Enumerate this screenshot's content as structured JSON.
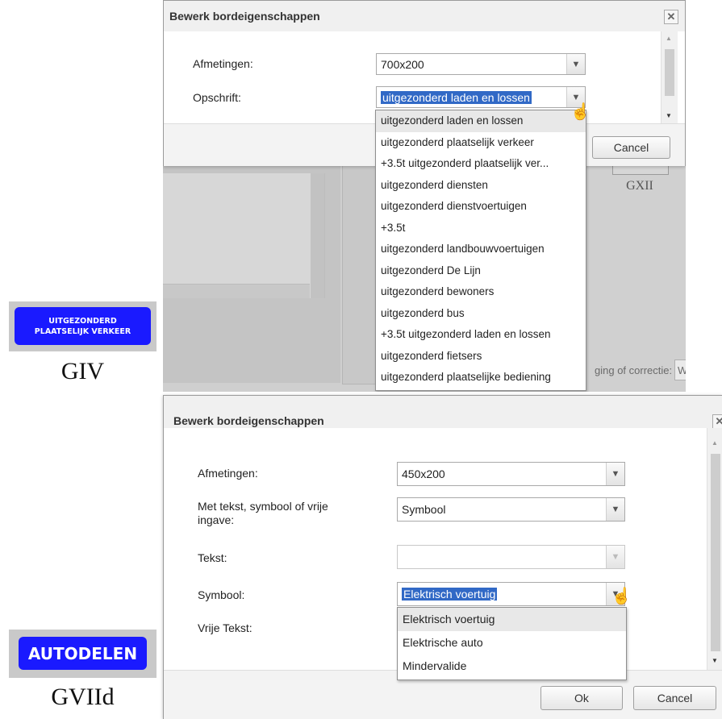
{
  "signs": [
    {
      "line1": "UITGEZONDERD",
      "line2": "PLAATSELIJK VERKEER",
      "code": "GIV"
    },
    {
      "line1": "AUTODELEN",
      "code": "GVIId"
    }
  ],
  "background": {
    "label_gxii": "GXII",
    "partial_text": "ging of correctie:",
    "partial_field": "W"
  },
  "dialog1": {
    "title": "Bewerk bordeigenschappen",
    "afmetingen_label": "Afmetingen:",
    "afmetingen_value": "700x200",
    "opschrift_label": "Opschrift:",
    "opschrift_value": "uitgezonderd laden en lossen",
    "cancel_label": "Cancel",
    "options": [
      "uitgezonderd laden en lossen",
      "uitgezonderd plaatselijk verkeer",
      "+3.5t uitgezonderd plaatselijk ver...",
      "uitgezonderd diensten",
      "uitgezonderd dienstvoertuigen",
      "+3.5t",
      "uitgezonderd landbouwvoertuigen",
      "uitgezonderd De Lijn",
      "uitgezonderd bewoners",
      "uitgezonderd bus",
      "+3.5t uitgezonderd laden en lossen",
      "uitgezonderd fietsers",
      "uitgezonderd plaatselijke bediening"
    ]
  },
  "dialog2": {
    "title": "Bewerk bordeigenschappen",
    "afmetingen_label": "Afmetingen:",
    "afmetingen_value": "450x200",
    "mode_label_line1": "Met tekst, symbool of vrije",
    "mode_label_line2": "ingave:",
    "mode_value": "Symbool",
    "tekst_label": "Tekst:",
    "tekst_value": "",
    "symbool_label": "Symbool:",
    "symbool_value": "Elektrisch voertuig",
    "vrije_tekst_label": "Vrije Tekst:",
    "options": [
      "Elektrisch voertuig",
      "Elektrische auto",
      "Mindervalide"
    ],
    "ok_label": "Ok",
    "cancel_label": "Cancel"
  },
  "icons": {
    "dropdown_arrow": "chevron-down-icon",
    "close": "close-icon",
    "cursor": "hand-pointer-icon",
    "scroll_up": "scroll-up-icon",
    "scroll_down": "scroll-down-icon"
  },
  "colors": {
    "sign_blue": "#1a1aff",
    "selection_blue": "#3169c6"
  }
}
